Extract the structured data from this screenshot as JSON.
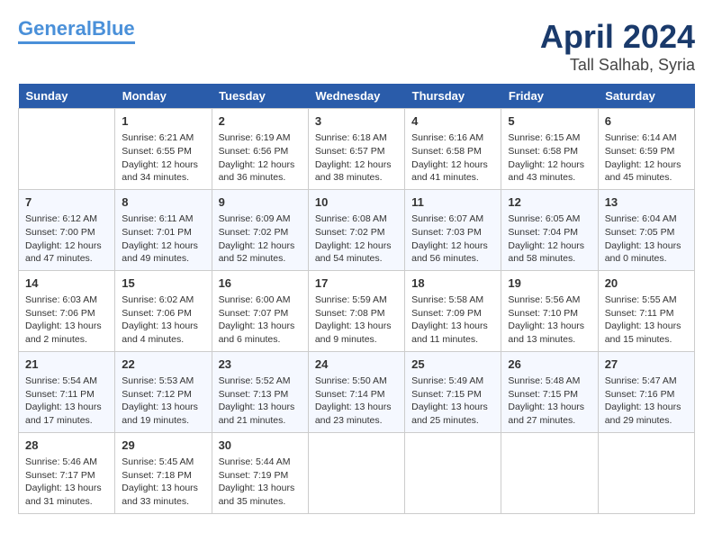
{
  "header": {
    "logo_line1": "General",
    "logo_line2": "Blue",
    "month_title": "April 2024",
    "location": "Tall Salhab, Syria"
  },
  "days_of_week": [
    "Sunday",
    "Monday",
    "Tuesday",
    "Wednesday",
    "Thursday",
    "Friday",
    "Saturday"
  ],
  "weeks": [
    [
      {
        "date": "",
        "info": ""
      },
      {
        "date": "1",
        "info": "Sunrise: 6:21 AM\nSunset: 6:55 PM\nDaylight: 12 hours\nand 34 minutes."
      },
      {
        "date": "2",
        "info": "Sunrise: 6:19 AM\nSunset: 6:56 PM\nDaylight: 12 hours\nand 36 minutes."
      },
      {
        "date": "3",
        "info": "Sunrise: 6:18 AM\nSunset: 6:57 PM\nDaylight: 12 hours\nand 38 minutes."
      },
      {
        "date": "4",
        "info": "Sunrise: 6:16 AM\nSunset: 6:58 PM\nDaylight: 12 hours\nand 41 minutes."
      },
      {
        "date": "5",
        "info": "Sunrise: 6:15 AM\nSunset: 6:58 PM\nDaylight: 12 hours\nand 43 minutes."
      },
      {
        "date": "6",
        "info": "Sunrise: 6:14 AM\nSunset: 6:59 PM\nDaylight: 12 hours\nand 45 minutes."
      }
    ],
    [
      {
        "date": "7",
        "info": "Sunrise: 6:12 AM\nSunset: 7:00 PM\nDaylight: 12 hours\nand 47 minutes."
      },
      {
        "date": "8",
        "info": "Sunrise: 6:11 AM\nSunset: 7:01 PM\nDaylight: 12 hours\nand 49 minutes."
      },
      {
        "date": "9",
        "info": "Sunrise: 6:09 AM\nSunset: 7:02 PM\nDaylight: 12 hours\nand 52 minutes."
      },
      {
        "date": "10",
        "info": "Sunrise: 6:08 AM\nSunset: 7:02 PM\nDaylight: 12 hours\nand 54 minutes."
      },
      {
        "date": "11",
        "info": "Sunrise: 6:07 AM\nSunset: 7:03 PM\nDaylight: 12 hours\nand 56 minutes."
      },
      {
        "date": "12",
        "info": "Sunrise: 6:05 AM\nSunset: 7:04 PM\nDaylight: 12 hours\nand 58 minutes."
      },
      {
        "date": "13",
        "info": "Sunrise: 6:04 AM\nSunset: 7:05 PM\nDaylight: 13 hours\nand 0 minutes."
      }
    ],
    [
      {
        "date": "14",
        "info": "Sunrise: 6:03 AM\nSunset: 7:06 PM\nDaylight: 13 hours\nand 2 minutes."
      },
      {
        "date": "15",
        "info": "Sunrise: 6:02 AM\nSunset: 7:06 PM\nDaylight: 13 hours\nand 4 minutes."
      },
      {
        "date": "16",
        "info": "Sunrise: 6:00 AM\nSunset: 7:07 PM\nDaylight: 13 hours\nand 6 minutes."
      },
      {
        "date": "17",
        "info": "Sunrise: 5:59 AM\nSunset: 7:08 PM\nDaylight: 13 hours\nand 9 minutes."
      },
      {
        "date": "18",
        "info": "Sunrise: 5:58 AM\nSunset: 7:09 PM\nDaylight: 13 hours\nand 11 minutes."
      },
      {
        "date": "19",
        "info": "Sunrise: 5:56 AM\nSunset: 7:10 PM\nDaylight: 13 hours\nand 13 minutes."
      },
      {
        "date": "20",
        "info": "Sunrise: 5:55 AM\nSunset: 7:11 PM\nDaylight: 13 hours\nand 15 minutes."
      }
    ],
    [
      {
        "date": "21",
        "info": "Sunrise: 5:54 AM\nSunset: 7:11 PM\nDaylight: 13 hours\nand 17 minutes."
      },
      {
        "date": "22",
        "info": "Sunrise: 5:53 AM\nSunset: 7:12 PM\nDaylight: 13 hours\nand 19 minutes."
      },
      {
        "date": "23",
        "info": "Sunrise: 5:52 AM\nSunset: 7:13 PM\nDaylight: 13 hours\nand 21 minutes."
      },
      {
        "date": "24",
        "info": "Sunrise: 5:50 AM\nSunset: 7:14 PM\nDaylight: 13 hours\nand 23 minutes."
      },
      {
        "date": "25",
        "info": "Sunrise: 5:49 AM\nSunset: 7:15 PM\nDaylight: 13 hours\nand 25 minutes."
      },
      {
        "date": "26",
        "info": "Sunrise: 5:48 AM\nSunset: 7:15 PM\nDaylight: 13 hours\nand 27 minutes."
      },
      {
        "date": "27",
        "info": "Sunrise: 5:47 AM\nSunset: 7:16 PM\nDaylight: 13 hours\nand 29 minutes."
      }
    ],
    [
      {
        "date": "28",
        "info": "Sunrise: 5:46 AM\nSunset: 7:17 PM\nDaylight: 13 hours\nand 31 minutes."
      },
      {
        "date": "29",
        "info": "Sunrise: 5:45 AM\nSunset: 7:18 PM\nDaylight: 13 hours\nand 33 minutes."
      },
      {
        "date": "30",
        "info": "Sunrise: 5:44 AM\nSunset: 7:19 PM\nDaylight: 13 hours\nand 35 minutes."
      },
      {
        "date": "",
        "info": ""
      },
      {
        "date": "",
        "info": ""
      },
      {
        "date": "",
        "info": ""
      },
      {
        "date": "",
        "info": ""
      }
    ]
  ]
}
